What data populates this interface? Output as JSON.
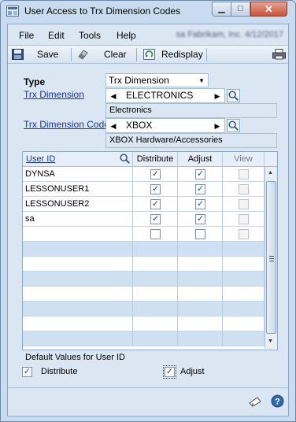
{
  "window": {
    "title": "User Access to Trx Dimension Codes"
  },
  "menu": {
    "file": "File",
    "edit": "Edit",
    "tools": "Tools",
    "help": "Help",
    "company_text": "sa  Fabrikam, Inc. 4/12/2017"
  },
  "toolbar": {
    "save": "Save",
    "clear": "Clear",
    "redisplay": "Redisplay"
  },
  "form": {
    "type_label": "Type",
    "type_value": "Trx Dimension",
    "trx_dimension_label": "Trx Dimension",
    "trx_dimension_value": "ELECTRONICS",
    "trx_dimension_desc": "Electronics",
    "trx_code_label": "Trx Dimension Code",
    "trx_code_value": "XBOX",
    "trx_code_desc": "XBOX Hardware/Accessories"
  },
  "grid": {
    "headers": {
      "user_id": "User ID",
      "distribute": "Distribute",
      "adjust": "Adjust",
      "view": "View"
    },
    "rows": [
      {
        "user": "DYNSA",
        "distribute": true,
        "adjust": true,
        "view": false
      },
      {
        "user": "LESSONUSER1",
        "distribute": true,
        "adjust": true,
        "view": false
      },
      {
        "user": "LESSONUSER2",
        "distribute": true,
        "adjust": true,
        "view": false
      },
      {
        "user": "sa",
        "distribute": true,
        "adjust": true,
        "view": false
      },
      {
        "user": "",
        "distribute": false,
        "adjust": false,
        "view": false
      }
    ]
  },
  "defaults": {
    "title": "Default Values for User ID",
    "distribute_label": "Distribute",
    "distribute_checked": true,
    "adjust_label": "Adjust",
    "adjust_checked": true
  },
  "colors": {
    "link": "#1a33a8",
    "row_alt": "#cfe0f3",
    "window_bg": "#dae6f2"
  }
}
